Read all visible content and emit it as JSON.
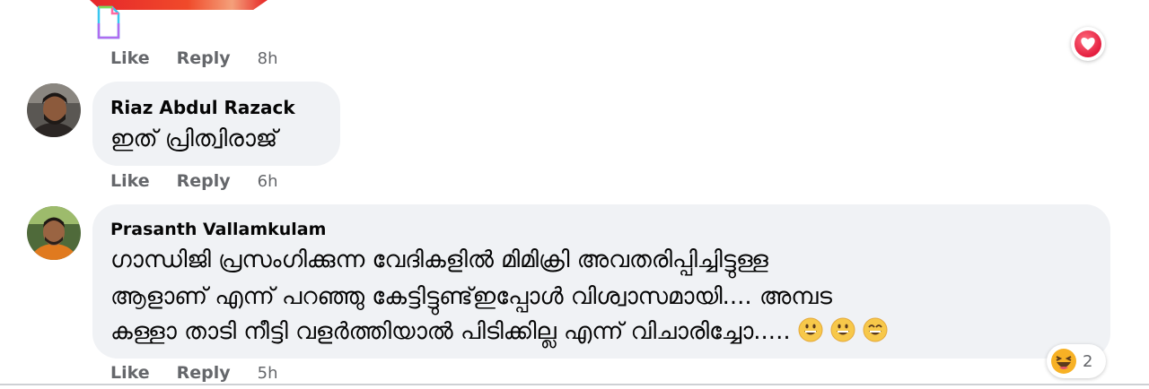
{
  "comments": [
    {
      "actions": {
        "like": "Like",
        "reply": "Reply",
        "time": "8h"
      },
      "reaction": {
        "icon": "heart-reaction-icon",
        "color": "#e41e3f"
      }
    },
    {
      "author": "Riaz Abdul Razack",
      "text": "ഇത് പ്രിത്വിരാജ്",
      "actions": {
        "like": "Like",
        "reply": "Reply",
        "time": "6h"
      }
    },
    {
      "author": "Prasanth Vallamkulam",
      "lines": [
        "ഗാന്ധിജി പ്രസംഗിക്കുന്ന വേദികളിൽ മിമിക്രി അവതരിപ്പിച്ചിട്ടുള്ള",
        "ആളാണ് എന്ന് പറഞ്ഞു കേട്ടിട്ടുണ്ട്ഇപ്പോൾ വിശ്വാസമായി.... അമ്പട",
        "കള്ളാ താടി നീട്ടി വളർത്തിയാൽ പിടിക്കില്ല എന്ന് വിചാരിച്ചോ....."
      ],
      "inline_emojis": [
        "grinning-emoji",
        "grinning-emoji",
        "smiling-eyes-emoji"
      ],
      "actions": {
        "like": "Like",
        "reply": "Reply",
        "time": "5h"
      },
      "reaction": {
        "icon": "laughing-reaction-icon",
        "count": "2"
      }
    }
  ],
  "colors": {
    "bubble": "#f0f2f5",
    "secondary_text": "#65676b",
    "love": "#e41e3f",
    "haha": "#f7b125"
  }
}
